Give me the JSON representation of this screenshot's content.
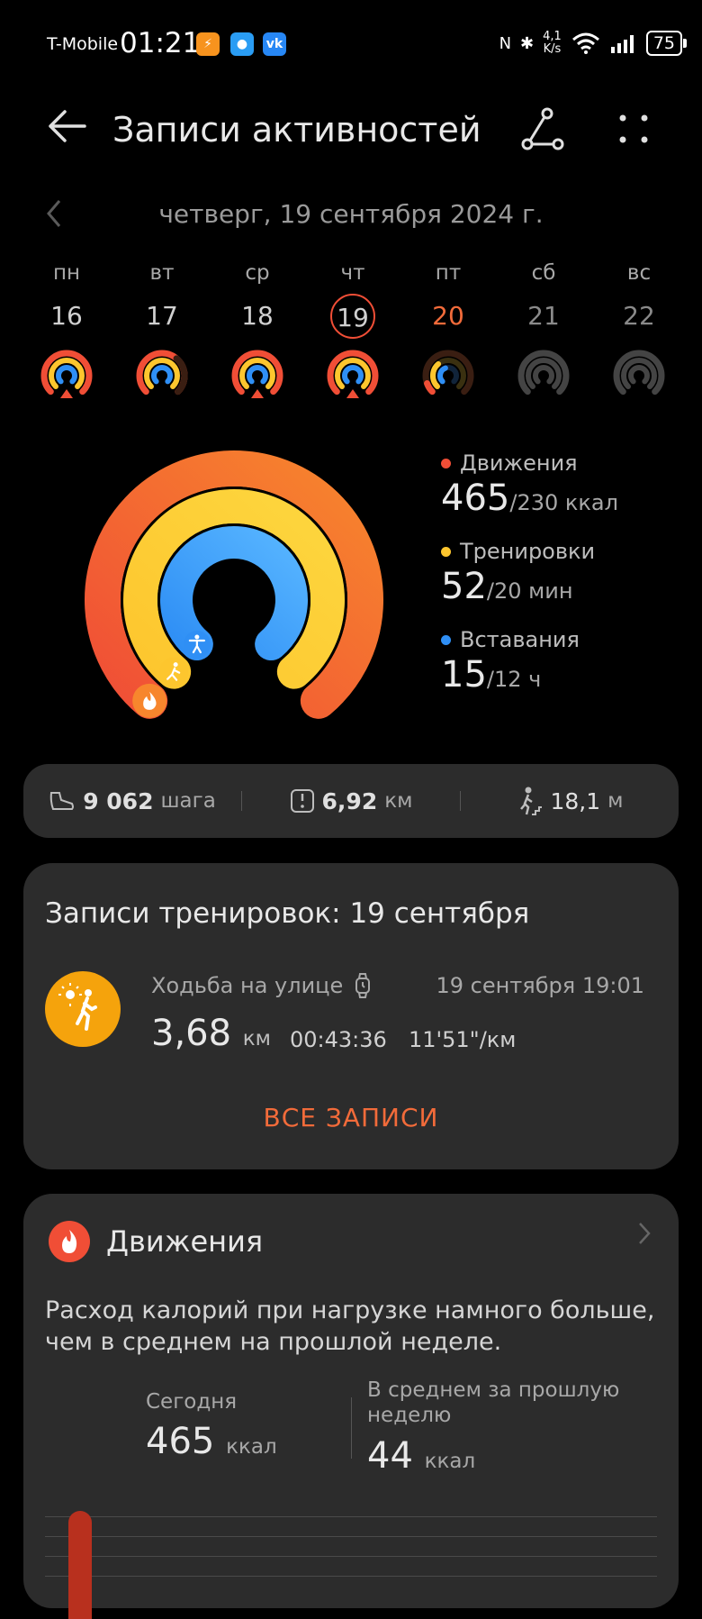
{
  "status": {
    "carrier": "T-Mobile",
    "time": "01:21",
    "net_speed_top": "4,1",
    "net_speed_bottom": "K/s",
    "battery": "75"
  },
  "header": {
    "title": "Записи активностей"
  },
  "date": {
    "current": "четверг, 19 сентября 2024 г."
  },
  "week": [
    {
      "name": "пн",
      "num": "16",
      "state": "done"
    },
    {
      "name": "вт",
      "num": "17",
      "state": "partial"
    },
    {
      "name": "ср",
      "num": "18",
      "state": "done"
    },
    {
      "name": "чт",
      "num": "19",
      "state": "today"
    },
    {
      "name": "пт",
      "num": "20",
      "state": "next"
    },
    {
      "name": "сб",
      "num": "21",
      "state": "future"
    },
    {
      "name": "вс",
      "num": "22",
      "state": "future"
    }
  ],
  "rings": {
    "move": {
      "label": "Движения",
      "value": "465",
      "goal": "/230 ккал",
      "color": "#f04e36",
      "fraction": 1.0
    },
    "exercise": {
      "label": "Тренировки",
      "value": "52",
      "goal": "/20 мин",
      "color": "#fdc62e",
      "fraction": 1.0
    },
    "stand": {
      "label": "Вставания",
      "value": "15",
      "goal": "/12 ч",
      "color": "#2f8ff5",
      "fraction": 1.0
    }
  },
  "stats": {
    "steps_value": "9 062",
    "steps_unit": "шага",
    "distance_value": "6,92",
    "distance_unit": "км",
    "climb_value": "18,1",
    "climb_unit": "м"
  },
  "workouts": {
    "title": "Записи тренировок: 19 сентября",
    "item": {
      "name": "Ходьба на улице",
      "datetime": "19 сентября 19:01",
      "distance": "3,68",
      "distance_unit": "км",
      "duration": "00:43:36",
      "pace": "11'51\"/км"
    },
    "all_label": "ВСЕ ЗАПИСИ"
  },
  "move_card": {
    "title": "Движения",
    "message": "Расход калорий при нагрузке намного больше, чем в среднем на прошлой неделе.",
    "today_label": "Сегодня",
    "today_value": "465",
    "today_unit": "ккал",
    "avg_label": "В среднем за прошлую неделю",
    "avg_value": "44",
    "avg_unit": "ккал"
  }
}
